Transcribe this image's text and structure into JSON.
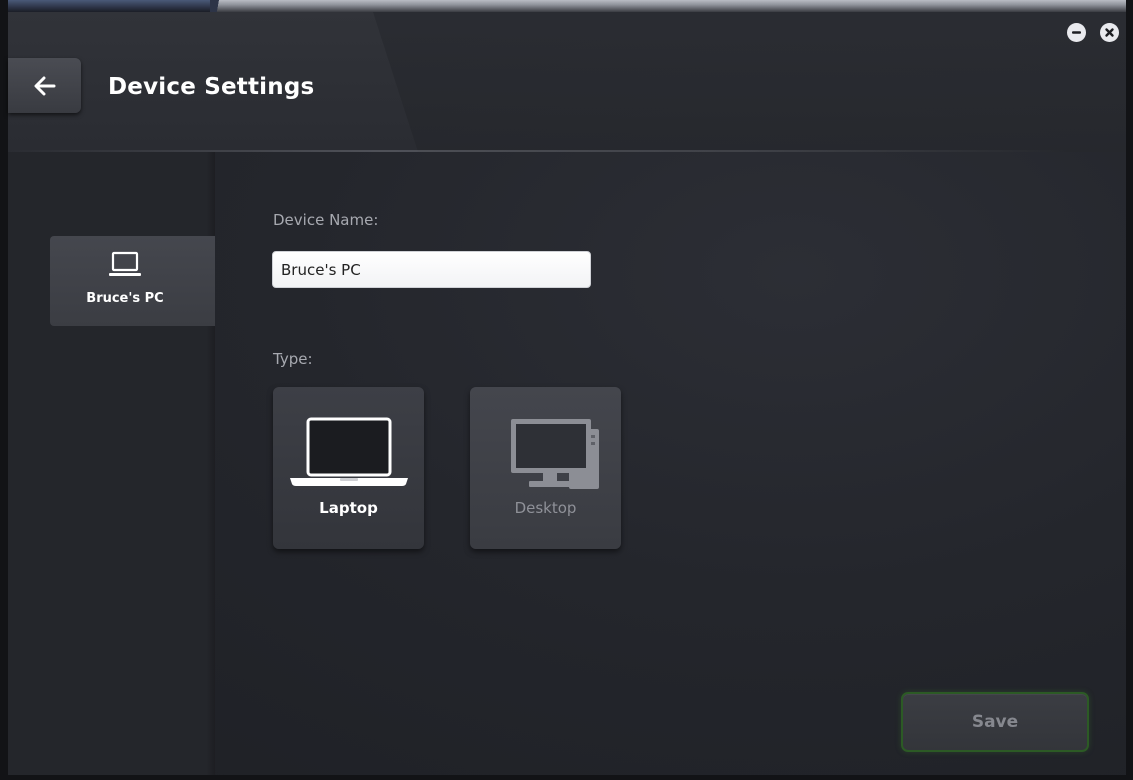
{
  "header": {
    "title": "Device Settings",
    "back_icon": "arrow-left-icon"
  },
  "window_controls": {
    "minimize_icon": "minus-icon",
    "close_icon": "close-icon"
  },
  "sidebar": {
    "items": [
      {
        "label": "Bruce's PC",
        "icon": "laptop-icon",
        "selected": true
      }
    ]
  },
  "form": {
    "device_name_label": "Device Name:",
    "device_name_value": "Bruce's PC",
    "type_label": "Type:",
    "types": [
      {
        "label": "Laptop",
        "icon": "laptop-icon",
        "selected": true
      },
      {
        "label": "Desktop",
        "icon": "desktop-icon",
        "selected": false
      }
    ]
  },
  "footer": {
    "save_label": "Save"
  },
  "colors": {
    "background": "#24262c",
    "accent_border": "#2c5a25",
    "label_gray": "#a7a9b0",
    "disabled_text": "#86888f"
  }
}
